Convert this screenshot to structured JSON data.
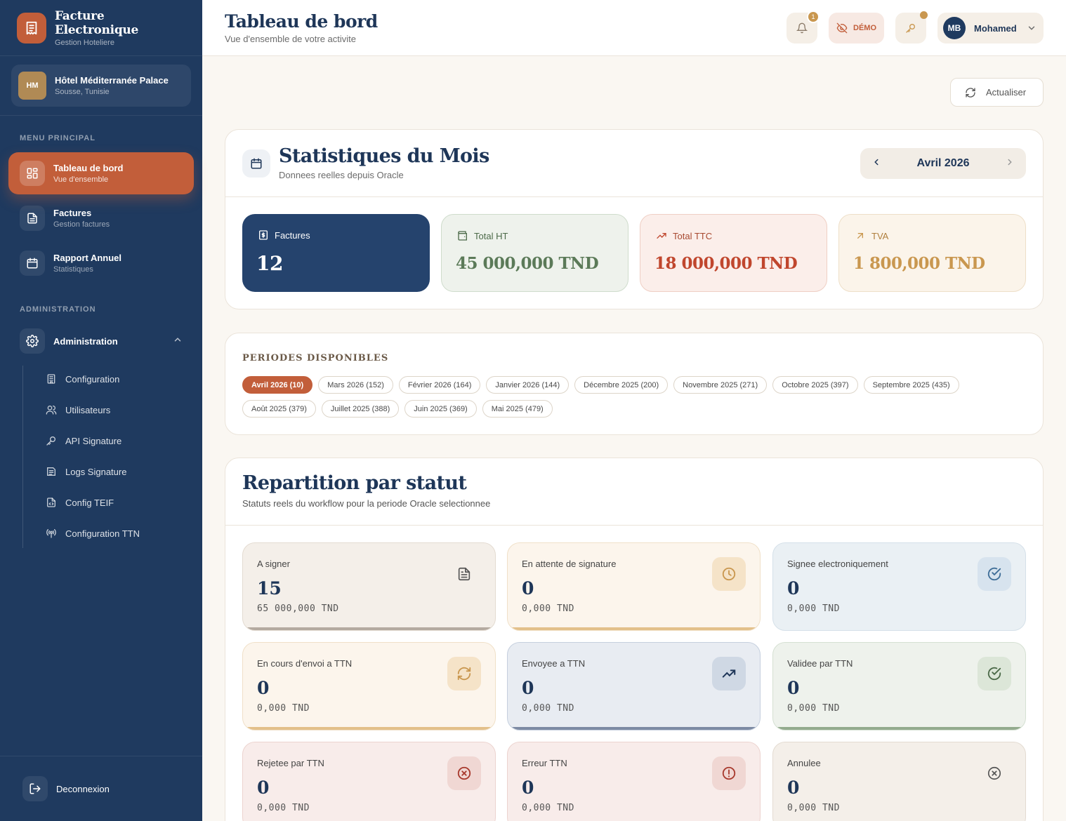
{
  "brand": {
    "title": "Facture Electronique",
    "subtitle": "Gestion Hoteliere"
  },
  "hotel": {
    "initials": "HM",
    "name": "Hôtel Méditerranée Palace",
    "location": "Sousse, Tunisie"
  },
  "sidebar": {
    "main_label": "MENU PRINCIPAL",
    "items": [
      {
        "label": "Tableau de bord",
        "sub": "Vue d'ensemble",
        "icon": "grid-icon",
        "active": true
      },
      {
        "label": "Factures",
        "sub": "Gestion factures",
        "icon": "document-icon"
      },
      {
        "label": "Rapport Annuel",
        "sub": "Statistiques",
        "icon": "calendar-icon"
      }
    ],
    "admin_label": "ADMINISTRATION",
    "admin": {
      "label": "Administration",
      "icon": "gear-icon"
    },
    "sub_items": [
      {
        "label": "Configuration",
        "icon": "building-icon"
      },
      {
        "label": "Utilisateurs",
        "icon": "users-icon"
      },
      {
        "label": "API Signature",
        "icon": "key-icon"
      },
      {
        "label": "Logs Signature",
        "icon": "log-icon"
      },
      {
        "label": "Config TEIF",
        "icon": "file-code-icon"
      },
      {
        "label": "Configuration TTN",
        "icon": "antenna-icon"
      }
    ],
    "logout": "Deconnexion"
  },
  "header": {
    "title": "Tableau de bord",
    "subtitle": "Vue d'ensemble de votre activite",
    "notifications": "1",
    "demo": "DÉMO",
    "user_initials": "MB",
    "user_name": "Mohamed"
  },
  "refresh_label": "Actualiser",
  "stats": {
    "title": "Statistiques du Mois",
    "subtitle": "Donnees reelles depuis Oracle",
    "month": "Avril 2026",
    "kpis": [
      {
        "label": "Factures",
        "value": "12"
      },
      {
        "label": "Total HT",
        "value": "45 000,000 TND"
      },
      {
        "label": "Total TTC",
        "value": "18 000,000 TND"
      },
      {
        "label": "TVA",
        "value": "1 800,000 TND"
      }
    ]
  },
  "periods": {
    "title": "PERIODES DISPONIBLES",
    "items": [
      "Avril 2026 (10)",
      "Mars 2026 (152)",
      "Février 2026 (164)",
      "Janvier 2026 (144)",
      "Décembre 2025 (200)",
      "Novembre 2025 (271)",
      "Octobre 2025 (397)",
      "Septembre 2025 (435)",
      "Août 2025 (379)",
      "Juillet 2025 (388)",
      "Juin 2025 (369)",
      "Mai 2025 (479)"
    ],
    "active_index": 0
  },
  "repartition": {
    "title": "Repartition par statut",
    "subtitle": "Statuts reels du workflow pour la periode Oracle selectionnee",
    "cards": [
      {
        "label": "A signer",
        "count": "15",
        "amount": "65 000,000 TND",
        "icon": "document-icon"
      },
      {
        "label": "En attente de signature",
        "count": "0",
        "amount": "0,000 TND",
        "icon": "clock-icon"
      },
      {
        "label": "Signee electroniquement",
        "count": "0",
        "amount": "0,000 TND",
        "icon": "check-circle-icon"
      },
      {
        "label": "En cours d'envoi a TTN",
        "count": "0",
        "amount": "0,000 TND",
        "icon": "refresh-icon"
      },
      {
        "label": "Envoyee a TTN",
        "count": "0",
        "amount": "0,000 TND",
        "icon": "trend-up-icon"
      },
      {
        "label": "Validee par TTN",
        "count": "0",
        "amount": "0,000 TND",
        "icon": "check-circle-icon"
      },
      {
        "label": "Rejetee par TTN",
        "count": "0",
        "amount": "0,000 TND",
        "icon": "x-circle-icon"
      },
      {
        "label": "Erreur TTN",
        "count": "0",
        "amount": "0,000 TND",
        "icon": "alert-circle-icon"
      },
      {
        "label": "Annulee",
        "count": "0",
        "amount": "0,000 TND",
        "icon": "x-circle-icon"
      }
    ]
  },
  "colors": {
    "sidebar": "#1f3a5f",
    "accent": "#c25e3a",
    "gold": "#c9974f",
    "navy": "#1e3658",
    "green": "#5b7a58",
    "red": "#c0462d"
  }
}
